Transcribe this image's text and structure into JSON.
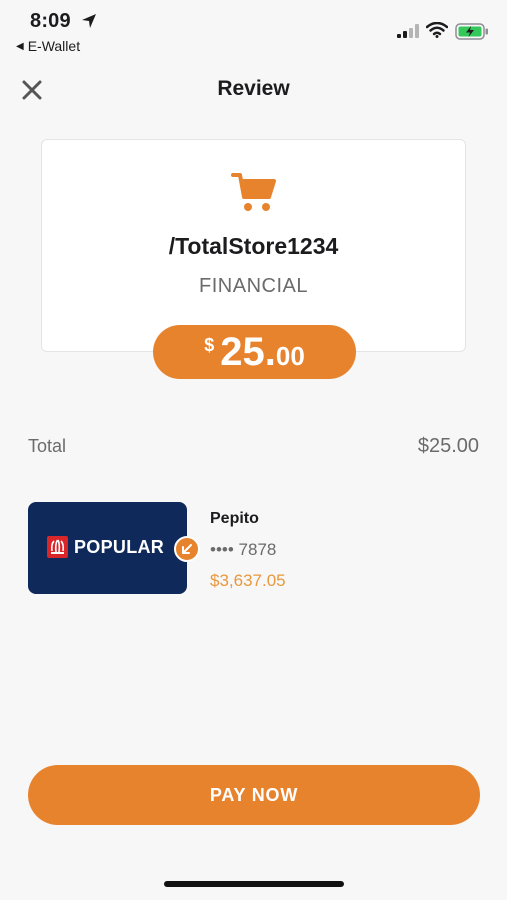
{
  "status_bar": {
    "time": "8:09",
    "back_app_label": "E-Wallet"
  },
  "nav": {
    "title": "Review"
  },
  "merchant": {
    "name": "/TotalStore1234",
    "type": "FINANCIAL"
  },
  "amount": {
    "currency_symbol": "$",
    "integer": "25",
    "dot": ".",
    "decimal": "00"
  },
  "total": {
    "label": "Total",
    "value": "$25.00"
  },
  "payment_method": {
    "bank_name": "POPULAR",
    "account_holder": "Pepito",
    "masked_number": "•••• 7878",
    "balance": "$3,637.05"
  },
  "actions": {
    "pay_label": "PAY NOW"
  },
  "colors": {
    "accent": "#e8832d",
    "card_navy": "#0f2a5a",
    "logo_red": "#d9262b"
  }
}
